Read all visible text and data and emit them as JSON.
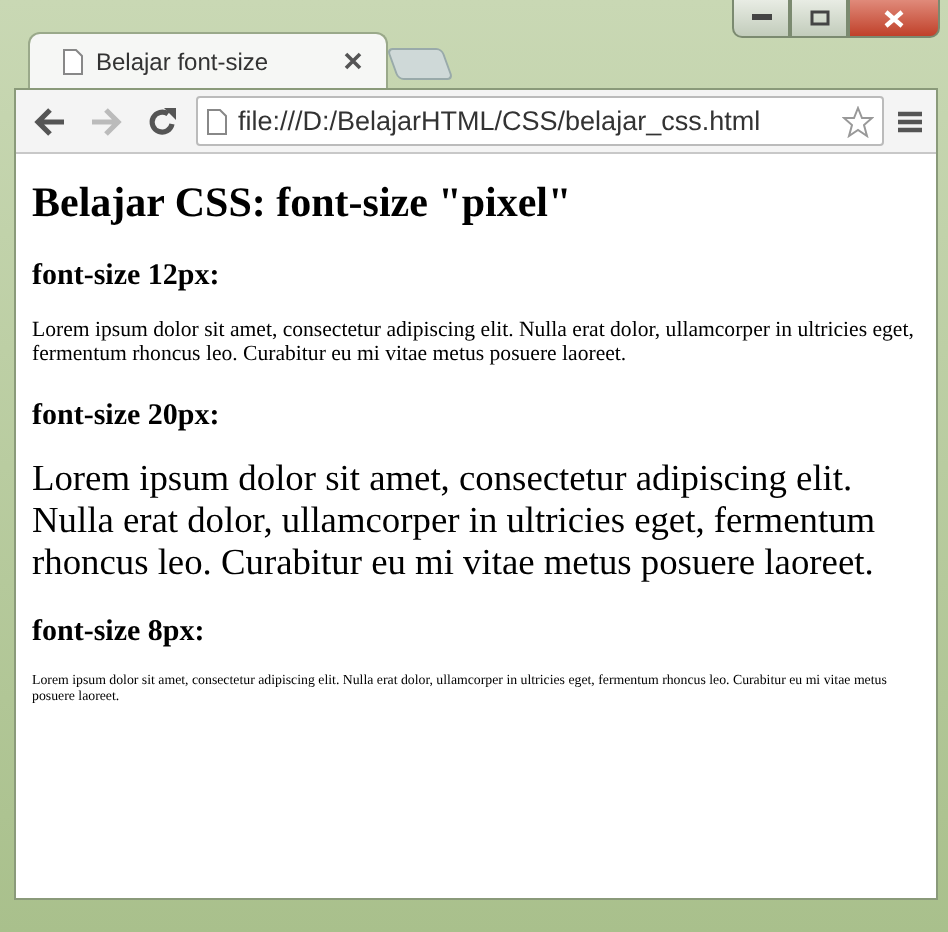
{
  "tabs": [
    {
      "title": "Belajar font-size",
      "selected": true
    }
  ],
  "toolbar": {
    "buttons": [
      {
        "kind": "back",
        "disabled": false
      },
      {
        "kind": "forward",
        "disabled": true
      },
      {
        "kind": "reload",
        "disabled": false
      }
    ],
    "address": "file:///D:/BelajarHTML/CSS/belajar_css.html"
  },
  "page": {
    "title": "Belajar CSS: font-size \"pixel\"",
    "sections": [
      {
        "heading": "font-size 12px:",
        "kind": "small",
        "text": "Lorem ipsum dolor sit amet, consectetur adipiscing elit. Nulla erat dolor, ullamcorper in ultricies eget, fermentum rhoncus leo. Curabitur eu mi vitae metus posuere laoreet."
      },
      {
        "heading": "font-size 20px:",
        "kind": "large",
        "text": "Lorem ipsum dolor sit amet, consectetur adipiscing elit. Nulla erat dolor, ullamcorper in ultricies eget, fermentum rhoncus leo. Curabitur eu mi vitae metus posuere laoreet."
      },
      {
        "heading": "font-size 8px:",
        "kind": "tiny",
        "text": "Lorem ipsum dolor sit amet, consectetur adipiscing elit. Nulla erat dolor, ullamcorper in ultricies eget, fermentum rhoncus leo. Curabitur eu mi vitae metus posuere laoreet."
      }
    ]
  }
}
